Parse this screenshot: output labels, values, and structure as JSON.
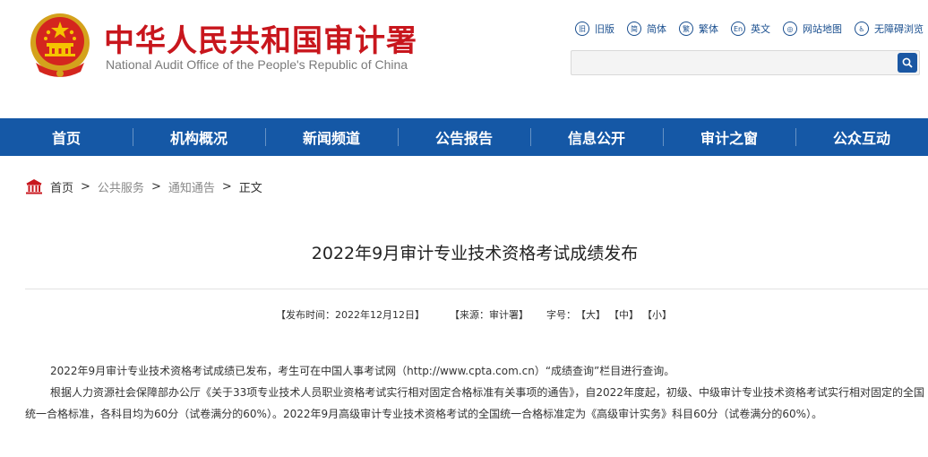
{
  "header": {
    "title": "中华人民共和国审计署",
    "subtitle": "National Audit Office of the People's Republic of China"
  },
  "toplinks": [
    {
      "label": "旧版",
      "icon": "旧",
      "icon_name": "old-version-icon"
    },
    {
      "label": "简体",
      "icon": "简",
      "icon_name": "simplified-icon"
    },
    {
      "label": "繁体",
      "icon": "繁",
      "icon_name": "traditional-icon"
    },
    {
      "label": "英文",
      "icon": "En",
      "icon_name": "english-icon"
    },
    {
      "label": "网站地图",
      "icon": "◎",
      "icon_name": "sitemap-icon"
    },
    {
      "label": "无障碍浏览",
      "icon": "♿",
      "icon_name": "accessibility-icon"
    }
  ],
  "search": {
    "placeholder": "",
    "value": ""
  },
  "nav": [
    "首页",
    "机构概况",
    "新闻频道",
    "公告报告",
    "信息公开",
    "审计之窗",
    "公众互动"
  ],
  "breadcrumb": {
    "home": "首页",
    "sep": ">",
    "level1": "公共服务",
    "level2": "通知通告",
    "current": "正文"
  },
  "article": {
    "title": "2022年9月审计专业技术资格考试成绩发布",
    "published": "【发布时间：2022年12月12日】",
    "source": "【来源：审计署】",
    "font_label": "字号：",
    "font_large": "【大】",
    "font_medium": "【中】",
    "font_small": "【小】",
    "paragraphs": [
      "2022年9月审计专业技术资格考试成绩已发布，考生可在中国人事考试网（http://www.cpta.com.cn）“成绩查询”栏目进行查询。",
      "根据人力资源社会保障部办公厅《关于33项专业技术人员职业资格考试实行相对固定合格标准有关事项的通告》，自2022年度起，初级、中级审计专业技术资格考试实行相对固定的全国统一合格标准，各科目均为60分（试卷满分的60%）。2022年9月高级审计专业技术资格考试的全国统一合格标准定为《高级审计实务》科目60分（试卷满分的60%）。"
    ]
  },
  "colors": {
    "brand_red": "#c8161d",
    "nav_blue": "#1558a6",
    "link_blue": "#1a4f8f"
  }
}
